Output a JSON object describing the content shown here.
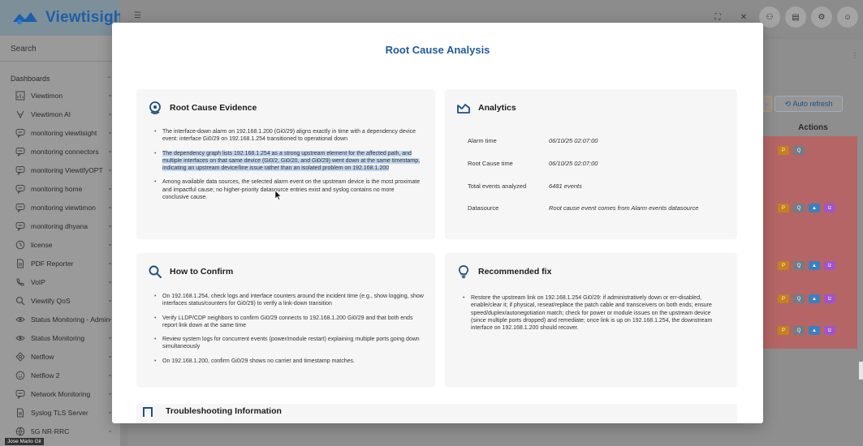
{
  "app": {
    "name": "Viewtisight",
    "search_label": "Search",
    "section": "Dashboards",
    "user_tooltip": "Jose Mario Gil"
  },
  "sidebar": {
    "items": [
      {
        "label": "Viewtimon",
        "icon": "dashboard-grid-icon"
      },
      {
        "label": "Viewtimon AI",
        "icon": "ai-sparkle-icon"
      },
      {
        "label": "monitoring viewtisight",
        "icon": "monitor-chat-icon"
      },
      {
        "label": "monitoring connectors",
        "icon": "monitor-chat-icon"
      },
      {
        "label": "monitoring ViewtifyOPT",
        "icon": "monitor-chat-icon"
      },
      {
        "label": "monitoring home",
        "icon": "monitor-chat-icon"
      },
      {
        "label": "monitoring viewtimon",
        "icon": "monitor-chat-icon"
      },
      {
        "label": "monitoring dhyana",
        "icon": "monitor-chat-icon"
      },
      {
        "label": "license",
        "icon": "clock-icon"
      },
      {
        "label": "PDF Reporter",
        "icon": "document-icon"
      },
      {
        "label": "VoIP",
        "icon": "phone-icon"
      },
      {
        "label": "Viewtify QoS",
        "icon": "search-icon"
      },
      {
        "label": "Status Monitoring - Admin",
        "icon": "eye-icon"
      },
      {
        "label": "Status Monitoring",
        "icon": "eye-icon"
      },
      {
        "label": "Netflow",
        "icon": "diamond-icon"
      },
      {
        "label": "Netflow 2",
        "icon": "smile-icon"
      },
      {
        "label": "Network Monitoring",
        "icon": "monitor-chat-icon"
      },
      {
        "label": "Syslog TLS Server",
        "icon": "document-icon"
      },
      {
        "label": "5G NR-RRC",
        "icon": "globe-icon"
      }
    ]
  },
  "background": {
    "auto_refresh": "Auto refresh",
    "actions_header": "Actions",
    "row_buttons": {
      "flag": "P",
      "search": "Q",
      "alert": "▲",
      "chart": "lz"
    }
  },
  "modal": {
    "title": "Root Cause Analysis",
    "evidence": {
      "title": "Root Cause Evidence",
      "bullets": [
        "The interface-down alarm on 192.168.1.200 (Gi0/29) aligns exactly in time with a dependency device event: interface Gi0/29 on 192.168.1.254 transitioned to operational down",
        "The dependency graph lists 192.168.1.254 as a strong upstream element for the affected path, and multiple interfaces on that same device (Gi0/2, Gi0/20, and Gi0/29) went down at the same timestamp, indicating an upstream device/line issue rather than an isolated problem on 192.168.1.200",
        "Among available data sources, the selected alarm event on the upstream device is the most proximate and impactful cause; no higher-priority datasource entries exist and syslog contains no more conclusive cause."
      ]
    },
    "analytics": {
      "title": "Analytics",
      "rows": [
        {
          "label": "Alarm time",
          "value": "06/10/25 02:07:00"
        },
        {
          "label": "Root Cause time",
          "value": "06/10/25 02:07:00"
        },
        {
          "label": "Total events analyzed",
          "value": "6481 events"
        },
        {
          "label": "Datasource",
          "value": "Root cause event comes from Alarm events datasource"
        }
      ]
    },
    "confirm": {
      "title": "How to Confirm",
      "bullets": [
        "On 192.168.1.254, check logs and interface counters around the incident time (e.g., show logging, show interfaces status/counters for Gi0/29) to verify a link-down transition",
        "Verify LLDP/CDP neighbors to confirm Gi0/29 connects to 192.168.1.200 Gi0/29 and that both ends report link down at the same time",
        "Review system logs for concurrent events (power/module restart) explaining multiple ports going down simultaneously",
        "On 192.168.1.200, confirm Gi0/29 shows no carrier and timestamp matches."
      ]
    },
    "fix": {
      "title": "Recommended fix",
      "bullets": [
        "Restore the upstream link on 192.168.1.254 Gi0/29: if administratively down or err-disabled, enable/clear it; if physical, reseat/replace the patch cable and transceivers on both ends; ensure speed/duplex/autonegotiation match; check for power or module issues on the upstream device (since multiple ports dropped) and remediate; once link is up on 192.168.1.254, the downstream interface on 192.168.1.200 should recover."
      ]
    },
    "troubleshooting": {
      "title": "Troubleshooting Information"
    }
  },
  "colors": {
    "brand": "#1e5fa8",
    "modal_title": "#1f5a9e",
    "highlight": "#c2d7f1",
    "alert_rows": "#b56565"
  }
}
